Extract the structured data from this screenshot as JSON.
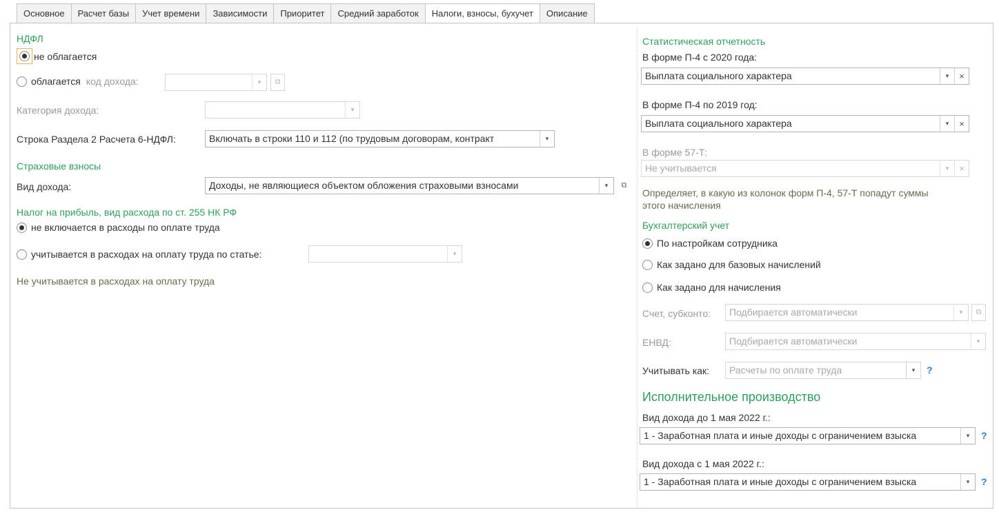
{
  "tabs": [
    {
      "label": "Основное"
    },
    {
      "label": "Расчет базы"
    },
    {
      "label": "Учет времени"
    },
    {
      "label": "Зависимости"
    },
    {
      "label": "Приоритет"
    },
    {
      "label": "Средний заработок"
    },
    {
      "label": "Налоги, взносы, бухучет",
      "active": true
    },
    {
      "label": "Описание"
    }
  ],
  "ndfl": {
    "title": "НДФЛ",
    "not_taxed_label": "не облагается",
    "not_taxed_selected": true,
    "taxed_label": "облагается",
    "income_code_label": "код дохода:",
    "income_code_value": "",
    "income_category_label": "Категория дохода:",
    "income_category_value": "",
    "section2_label": "Строка Раздела 2 Расчета 6-НДФЛ:",
    "section2_value": "Включать в строки 110 и 112 (по трудовым договорам, контракт"
  },
  "insurance": {
    "title": "Страховые взносы",
    "income_type_label": "Вид дохода:",
    "income_type_value": "Доходы, не являющиеся объектом обложения страховыми взносами"
  },
  "profit_tax": {
    "title": "Налог на прибыль, вид расхода по ст. 255 НК РФ",
    "not_included_label": "не включается в расходы по оплате труда",
    "not_included_selected": true,
    "included_label": "учитывается в расходах на оплату труда по статье:",
    "article_value": "",
    "note": "Не учитывается в расходах на оплату труда"
  },
  "stats": {
    "title": "Статистическая отчетность",
    "p4_2020_label": "В форме П-4 с 2020 года:",
    "p4_2020_value": "Выплата социального характера",
    "p4_2019_label": "В форме П-4 по 2019 год:",
    "p4_2019_value": "Выплата социального характера",
    "f57_label": "В форме 57-Т:",
    "f57_value": "Не учитывается",
    "note_line1": "Определяет, в какую из колонок форм П-4, 57-Т попадут суммы",
    "note_line2": "этого начисления"
  },
  "accounting": {
    "title": "Бухгалтерский учет",
    "option1": "По настройкам сотрудника",
    "option2": "Как задано для базовых начислений",
    "option3": "Как задано для начисления",
    "selected": 1,
    "account_label": "Счет, субконто:",
    "account_value": "Подбирается автоматически",
    "envd_label": "ЕНВД:",
    "envd_value": "Подбирается автоматически",
    "account_as_label": "Учитывать как:",
    "account_as_value": "Расчеты по оплате труда"
  },
  "enforcement": {
    "title": "Исполнительное производство",
    "before_label": "Вид дохода до 1 мая 2022 г.:",
    "before_value": "1 - Заработная плата и иные доходы с ограничением взыска",
    "after_label": "Вид дохода с 1 мая 2022 г.:",
    "after_value": "1 - Заработная плата и иные доходы с ограничением взыска"
  },
  "glyphs": {
    "dropdown": "▾",
    "clear": "×",
    "open": "⧉",
    "help": "?"
  },
  "colors": {
    "section_title": "#2e9e5b",
    "help": "#2a7bd6",
    "focus": "#e8b64b"
  }
}
